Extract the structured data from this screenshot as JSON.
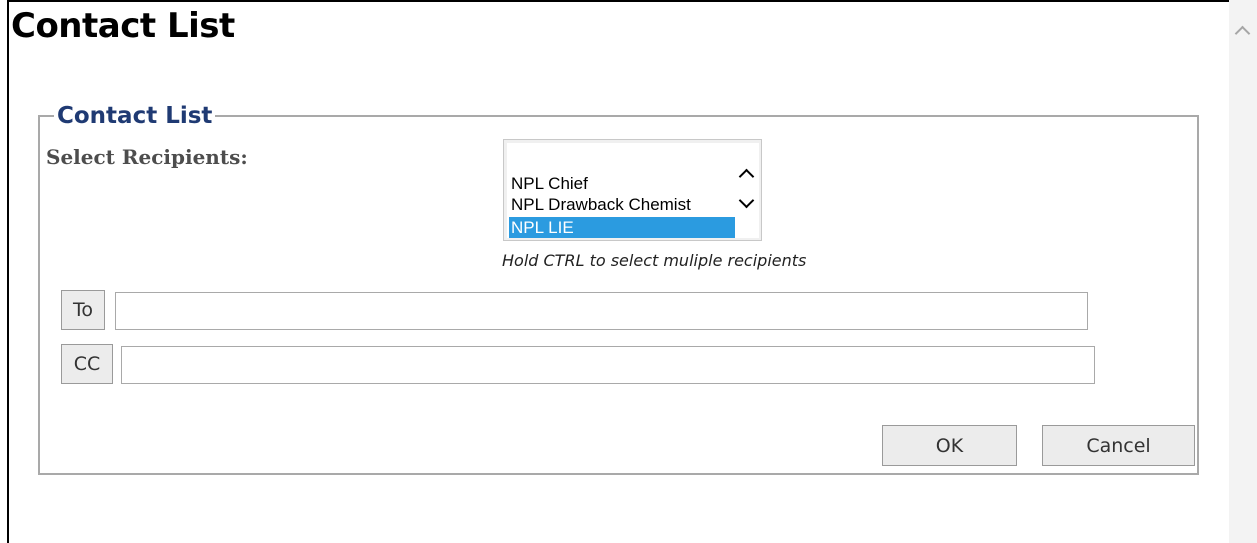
{
  "page": {
    "title": "Contact List"
  },
  "panel": {
    "legend": "Contact List",
    "select_label": "Select Recipients:"
  },
  "recipients": {
    "options": [
      {
        "label": "NPL Chief",
        "selected": false
      },
      {
        "label": "NPL Drawback Chemist",
        "selected": false
      },
      {
        "label": "NPL LIE",
        "selected": true
      }
    ],
    "hint": "Hold CTRL to select muliple recipients"
  },
  "to": {
    "button_label": "To",
    "value": ""
  },
  "cc": {
    "button_label": "CC",
    "value": ""
  },
  "actions": {
    "ok_label": "OK",
    "cancel_label": "Cancel"
  },
  "colors": {
    "legend": "#1f3a73",
    "selection": "#2b9be0",
    "border": "#a9a9a9"
  },
  "icons": {
    "scroll_up": "chevron-up-icon",
    "list_up": "chevron-up-icon",
    "list_down": "chevron-down-icon"
  }
}
